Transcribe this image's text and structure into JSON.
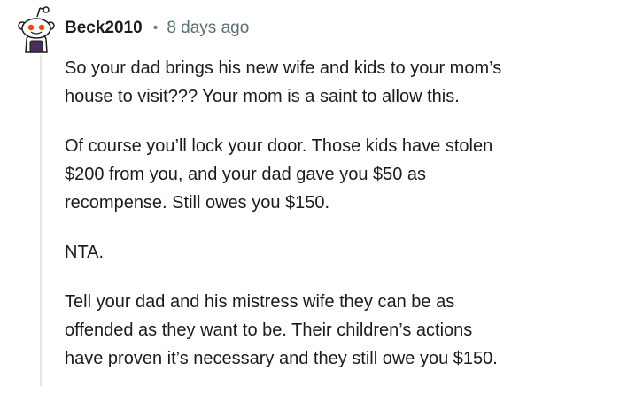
{
  "comment": {
    "author": "Beck2010",
    "separator": "•",
    "timestamp": "8 days ago",
    "avatar_icon": "snoo-avatar-icon",
    "paragraphs": [
      {
        "lines": [
          "So your dad brings his new wife and kids to your mom’s",
          "house to visit??? Your mom is a saint to allow this."
        ]
      },
      {
        "lines": [
          "Of course you’ll lock your door. Those kids have stolen",
          "$200 from you, and your dad gave you $50 as",
          "recompense. Still owes you $150."
        ]
      },
      {
        "lines": [
          "NTA."
        ]
      },
      {
        "lines": [
          "Tell your dad and his mistress wife they can be as",
          "offended as they want to be. Their children’s actions",
          "have proven it’s necessary and they still owe you $150."
        ]
      }
    ]
  },
  "colors": {
    "text": "#1c1c1c",
    "meta": "#576f76",
    "thread_line": "#e5e5e5"
  }
}
